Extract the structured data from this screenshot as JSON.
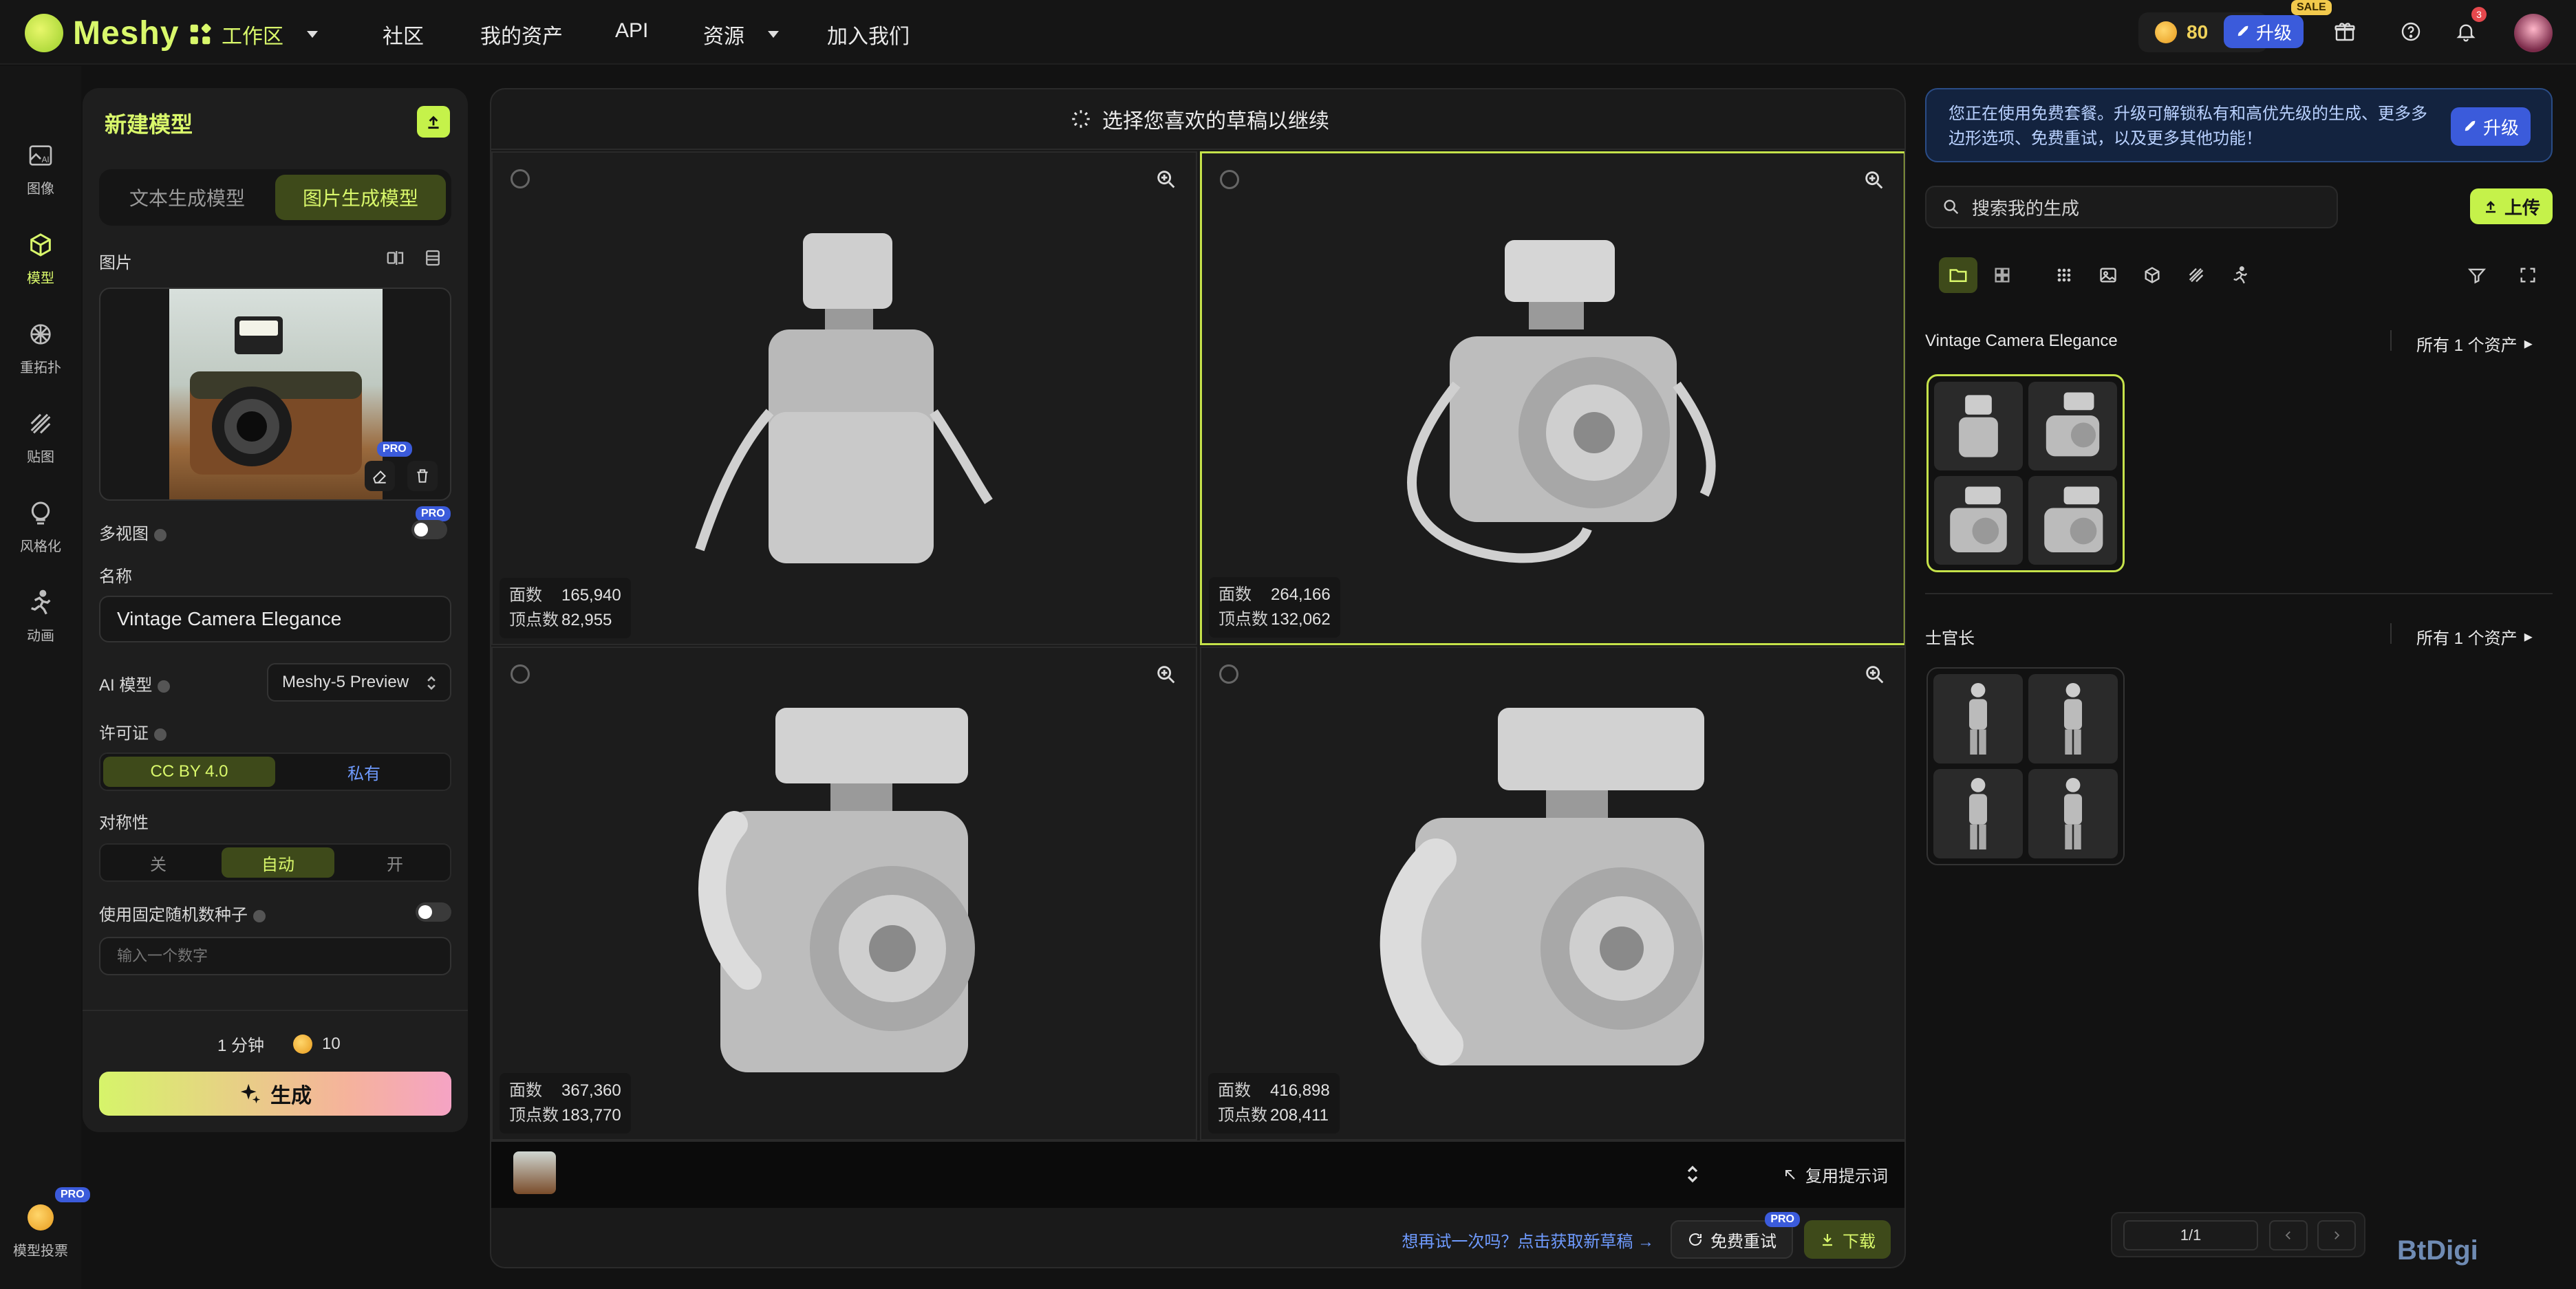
{
  "app": {
    "name": "Meshy"
  },
  "nav": {
    "workspace": "工作区",
    "community": "社区",
    "assets": "我的资产",
    "api": "API",
    "resources": "资源",
    "join": "加入我们"
  },
  "top": {
    "credits": "80",
    "upgrade": "升级",
    "sale": "SALE",
    "notifications": "3"
  },
  "rail": {
    "image": "图像",
    "model": "模型",
    "retopo": "重拓扑",
    "texture": "贴图",
    "stylize": "风格化",
    "animate": "动画",
    "vote": "模型投票",
    "pro": "PRO"
  },
  "panel": {
    "title": "新建模型",
    "tab_text": "文本生成模型",
    "tab_image": "图片生成模型",
    "image_label": "图片",
    "multiview_label": "多视图",
    "name_label": "名称",
    "name_value": "Vintage Camera Elegance",
    "ai_model_label": "AI 模型",
    "ai_model_value": "Meshy-5 Preview",
    "license_label": "许可证",
    "license_cc": "CC BY 4.0",
    "license_private": "私有",
    "symmetry_label": "对称性",
    "sym_off": "关",
    "sym_auto": "自动",
    "sym_on": "开",
    "seed_label": "使用固定随机数种子",
    "seed_placeholder": "输入一个数字",
    "time": "1 分钟",
    "cost": "10",
    "generate": "生成",
    "pro": "PRO"
  },
  "center": {
    "title": "选择您喜欢的草稿以继续",
    "faces_label": "面数",
    "verts_label": "顶点数",
    "drafts": [
      {
        "faces": "165,940",
        "verts": "82,955"
      },
      {
        "faces": "264,166",
        "verts": "132,062"
      },
      {
        "faces": "367,360",
        "verts": "183,770"
      },
      {
        "faces": "416,898",
        "verts": "208,411"
      }
    ],
    "reuse_prompt": "复用提示词",
    "retry_link": "想再试一次吗？点击获取新草稿",
    "free_retry": "免费重试",
    "download": "下载",
    "pro": "PRO"
  },
  "right": {
    "promo": "您正在使用免费套餐。升级可解锁私有和高优先级的生成、更多多边形选项、免费重试，以及更多其他功能！",
    "promo_btn": "升级",
    "search_placeholder": "搜索我的生成",
    "upload": "上传",
    "group1_title": "Vintage Camera Elegance",
    "group1_link": "所有 1 个资产",
    "group2_title": "士官长",
    "group2_link": "所有 1 个资产",
    "page": "1/1"
  },
  "watermark": "BtDigi"
}
